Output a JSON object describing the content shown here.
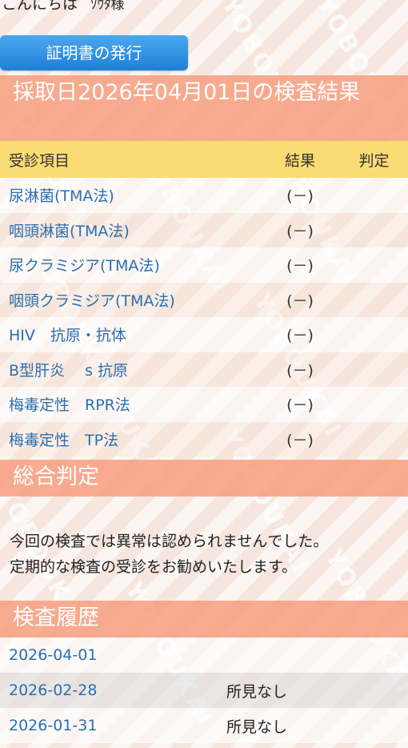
{
  "greeting": {
    "text": "こんにちは",
    "name": "ｿｳﾀ様"
  },
  "cert_button": {
    "label": "証明書の発行"
  },
  "result": {
    "heading": "採取日2026年04月01日の検査結果",
    "columns": {
      "item": "受診項目",
      "result": "結果",
      "judgement": "判定"
    },
    "rows": [
      {
        "item": "尿淋菌(TMA法)",
        "result": "(－)",
        "judgement": ""
      },
      {
        "item": "咽頭淋菌(TMA法)",
        "result": "(－)",
        "judgement": ""
      },
      {
        "item": "尿クラミジア(TMA法)",
        "result": "(－)",
        "judgement": ""
      },
      {
        "item": "咽頭クラミジア(TMA法)",
        "result": "(－)",
        "judgement": ""
      },
      {
        "item": "HIV　抗原・抗体",
        "result": "(－)",
        "judgement": ""
      },
      {
        "item": "B型肝炎　 s 抗原",
        "result": "(－)",
        "judgement": ""
      },
      {
        "item": "梅毒定性　RPR法",
        "result": "(－)",
        "judgement": ""
      },
      {
        "item": "梅毒定性　TP法",
        "result": "(－)",
        "judgement": ""
      }
    ]
  },
  "summary": {
    "heading": "総合判定",
    "line1": "今回の検査では異常は認められませんでした。",
    "line2": "定期的な検査の受診をお勧めいたします。"
  },
  "history": {
    "heading": "検査履歴",
    "rows": [
      {
        "date": "2026-04-01",
        "note": ""
      },
      {
        "date": "2026-02-28",
        "note": "所見なし"
      },
      {
        "date": "2026-01-31",
        "note": "所見なし"
      }
    ]
  },
  "watermark": "YOBOUKAI",
  "colors": {
    "section_header": "#f6a082",
    "table_header": "#f9dc73",
    "button": "#1f7fd6",
    "link_text": "#2b6fb0"
  }
}
